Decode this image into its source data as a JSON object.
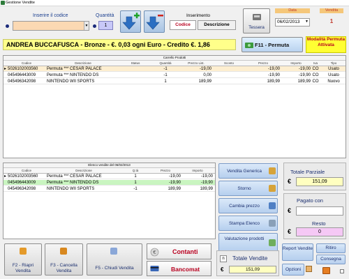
{
  "window": {
    "title": "Gestione Vendite"
  },
  "input": {
    "code_label": "Inserire il codice",
    "code_value": "",
    "qty_label": "Quantità",
    "qty_value": "1",
    "mode_label": "Inserimento",
    "tab_code": "Codice",
    "tab_desc": "Descrizione"
  },
  "tessera_label": "Tessera",
  "date": {
    "label": "Data",
    "value": "06/02/2013"
  },
  "vendita": {
    "label": "Vendita",
    "value": "1"
  },
  "customer_text": "ANDREA BUCCAFUSCA - Bronze - €. 0,03 ogni Euro - Credito €. 1,86",
  "permuta_button": "F11 - Permuta",
  "permuta_status": "Modalità Permuta Attivata",
  "cart": {
    "title": "Carrello Prodotti",
    "headers": [
      "Codice",
      "Descrizione",
      "Status",
      "Quantità",
      "Prezzo List.",
      "Sconto",
      "Prezzo",
      "Importo",
      "Iva",
      "Tipo"
    ],
    "rows": [
      {
        "code": "5026102003560",
        "desc": "Permuta *** CESAR PALACE",
        "status": "",
        "qty": "-1",
        "list": "-19,00",
        "disc": "",
        "price": "-19,00",
        "amount": "-19,00",
        "iva": "CO",
        "type": "Usato"
      },
      {
        "code": "045496443009",
        "desc": "Permuta *** NINTENDO DS",
        "status": "",
        "qty": "-1",
        "list": "0,00",
        "disc": "",
        "price": "-19,90",
        "amount": "-19,90",
        "iva": "CO",
        "type": "Usato"
      },
      {
        "code": "045496342098",
        "desc": "NINTENDO WII SPORTS",
        "status": "",
        "qty": "1",
        "list": "189,99",
        "disc": "",
        "price": "189,99",
        "amount": "189,99",
        "iva": "CO",
        "type": "Nuovo"
      }
    ]
  },
  "history": {
    "title": "Elenco vendite del 06/02/2013",
    "headers": [
      "Codice",
      "Descrizione",
      "Q.tà",
      "Prezzo",
      "Importo"
    ],
    "rows": [
      {
        "code": "5026102003560",
        "desc": "Permuta *** CESAR PALACE",
        "qty": "1",
        "price": "-19,00",
        "amount": "-19,00"
      },
      {
        "code": "045496443009",
        "desc": "Permuta *** NINTENDO DS",
        "qty": "1",
        "price": "-19,90",
        "amount": "-19,90"
      },
      {
        "code": "045496342098",
        "desc": "NINTENDO WII SPORTS",
        "qty": "-1",
        "price": "189,99",
        "amount": "189,99"
      }
    ]
  },
  "side_buttons": [
    "Vendita Generica",
    "Storno",
    "Cambia prezzo",
    "Stampa Elenco",
    "Valutazione prodotti"
  ],
  "totals": {
    "partial_label": "Totale Parziale",
    "currency": "€",
    "partial_value": "151,09",
    "paid_label": "Pagato con",
    "paid_value": "",
    "rest_label": "Resto",
    "rest_value": "0"
  },
  "bottom_buttons": {
    "f2": "F2 - Riapri Vendita",
    "f3": "F3 - Cancella Vendita",
    "f5": "F5 - Chiudi Vendita",
    "cash": "Contanti",
    "card": "Bancomat"
  },
  "total_sales": {
    "label": "Totale Vendite",
    "currency": "€",
    "value": "151,09"
  },
  "extra_buttons": {
    "report": "Report Vendite",
    "options": "Opzioni",
    "ritiro": "Ritiro",
    "consegna": "Consegna"
  }
}
